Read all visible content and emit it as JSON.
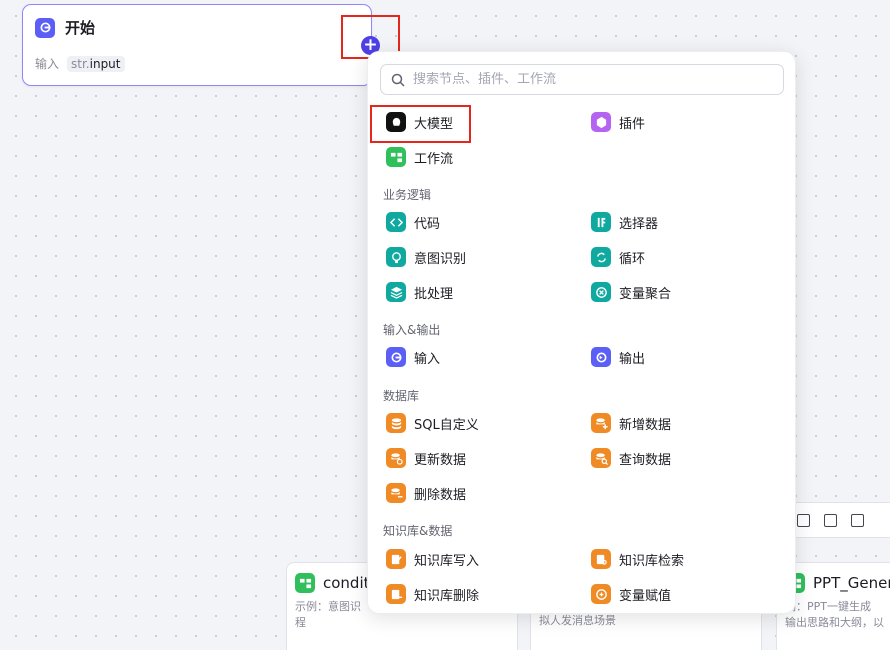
{
  "start_node": {
    "title": "开始",
    "input_label": "输入",
    "param_type": "str.",
    "param_name": "input"
  },
  "search": {
    "placeholder": "搜索节点、插件、工作流"
  },
  "menu": {
    "llm": "大模型",
    "plugin": "插件",
    "workflow": "工作流",
    "business_logic": {
      "title": "业务逻辑",
      "code": "代码",
      "selector": "选择器",
      "intent": "意图识别",
      "loop": "循环",
      "batch": "批处理",
      "var_merge": "变量聚合"
    },
    "io": {
      "title": "输入&输出",
      "input": "输入",
      "output": "输出"
    },
    "database": {
      "title": "数据库",
      "sql": "SQL自定义",
      "add": "新增数据",
      "update": "更新数据",
      "query": "查询数据",
      "delete": "删除数据"
    },
    "knowledge": {
      "title": "知识库&数据",
      "write": "知识库写入",
      "search": "知识库检索",
      "delete": "知识库删除",
      "assign": "变量赋值"
    }
  },
  "bg_nodes": {
    "n1": {
      "name": "condit",
      "desc1": "示例：意图识",
      "desc2": "程"
    },
    "n2": {
      "desc": "拟人发消息场景"
    },
    "n3": {
      "name": "PPT_Gener",
      "desc1": "例：PPT一键生成",
      "desc2": "输出思路和大纲，以"
    }
  },
  "colors": {
    "accent": "#4e40e5",
    "teal": "#10a9a0",
    "orange": "#f08a24",
    "green": "#2fbf5b",
    "purple": "#b464f0",
    "highlight": "#e5261c"
  }
}
